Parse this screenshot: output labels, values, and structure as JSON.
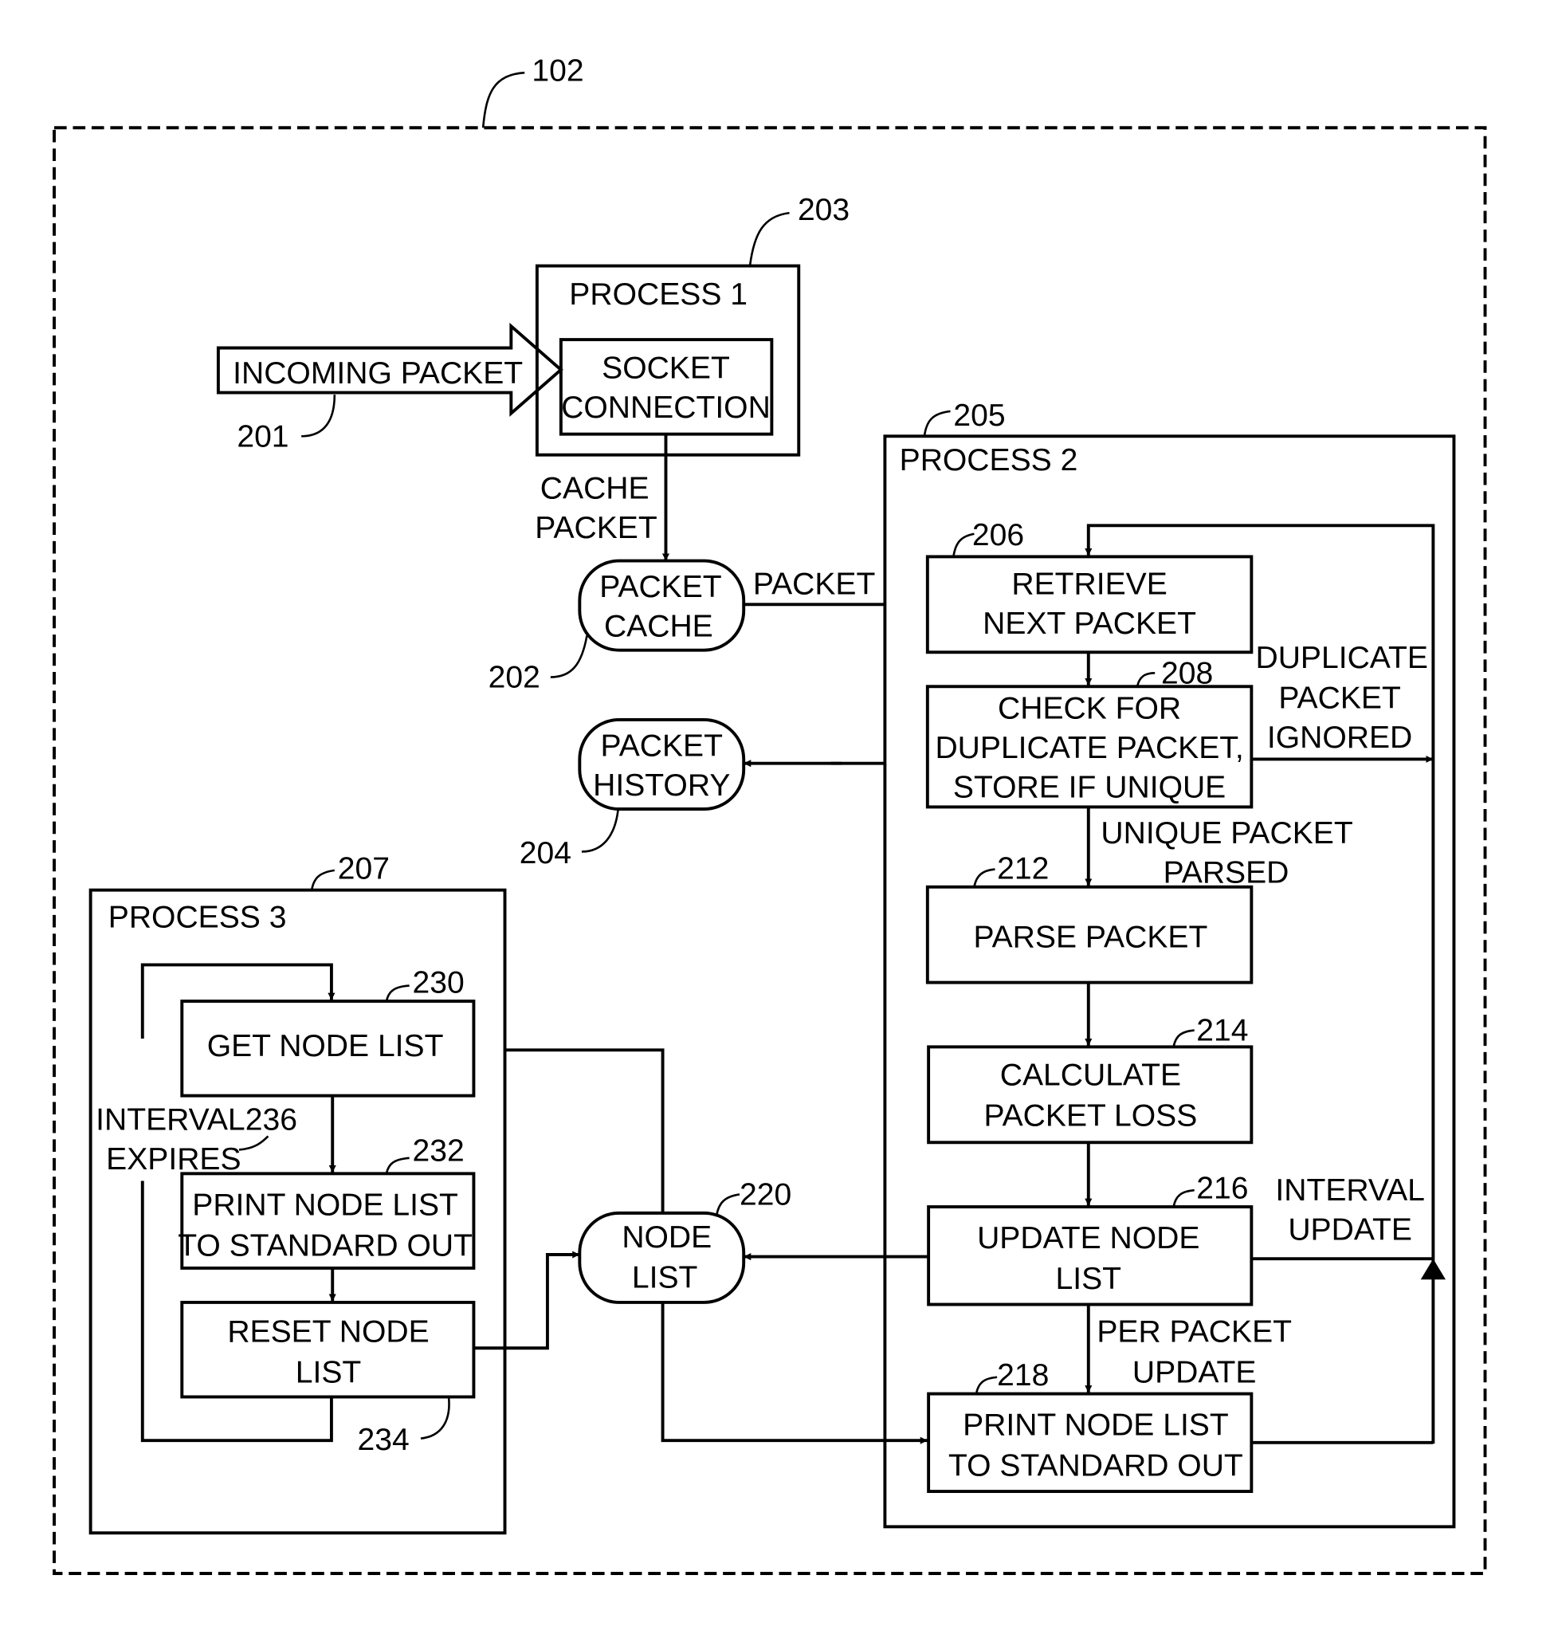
{
  "figure": {
    "system_ref": "102",
    "incoming": {
      "label": "INCOMING PACKET",
      "ref": "201"
    },
    "process1": {
      "title": "PROCESS 1",
      "ref": "203",
      "socket": [
        "SOCKET",
        "CONNECTION"
      ]
    },
    "cache_packet_label": [
      "CACHE",
      "PACKET"
    ],
    "packet_cache": {
      "lines": [
        "PACKET",
        "CACHE"
      ],
      "ref": "202"
    },
    "packet_label": "PACKET",
    "packet_history": {
      "lines": [
        "PACKET",
        "HISTORY"
      ],
      "ref": "204"
    },
    "node_list": {
      "lines": [
        "NODE",
        "LIST"
      ],
      "ref": "220"
    },
    "process2": {
      "title": "PROCESS 2",
      "ref": "205",
      "retrieve": {
        "lines": [
          "RETRIEVE",
          "NEXT PACKET"
        ],
        "ref": "206"
      },
      "check": {
        "lines": [
          "CHECK FOR",
          "DUPLICATE PACKET,",
          "STORE IF UNIQUE"
        ],
        "ref": "208"
      },
      "duplicate_label": [
        "DUPLICATE",
        "PACKET",
        "IGNORED"
      ],
      "unique_label": [
        "UNIQUE PACKET",
        "PARSED"
      ],
      "parse": {
        "lines": [
          "PARSE PACKET"
        ],
        "ref": "212"
      },
      "calc": {
        "lines": [
          "CALCULATE",
          "PACKET LOSS"
        ],
        "ref": "214"
      },
      "update": {
        "lines": [
          "UPDATE NODE",
          "LIST"
        ],
        "ref": "216"
      },
      "interval_update_label": [
        "INTERVAL",
        "UPDATE"
      ],
      "per_packet_label": [
        "PER PACKET",
        "UPDATE"
      ],
      "print": {
        "lines": [
          "PRINT NODE LIST",
          "TO STANDARD OUT"
        ],
        "ref": "218"
      }
    },
    "process3": {
      "title": "PROCESS 3",
      "ref": "207",
      "get": {
        "lines": [
          "GET NODE LIST"
        ],
        "ref": "230"
      },
      "print": {
        "lines": [
          "PRINT NODE LIST",
          "TO STANDARD OUT"
        ],
        "ref": "232"
      },
      "reset": {
        "lines": [
          "RESET NODE",
          "LIST"
        ],
        "ref": "234"
      },
      "interval_label": [
        "INTERVAL",
        "EXPIRES"
      ],
      "interval_ref": "236"
    }
  }
}
